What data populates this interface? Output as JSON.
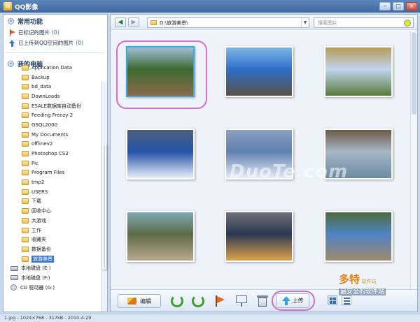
{
  "window": {
    "title": "QQ影像",
    "logo_text": "Q",
    "min": "–",
    "max": "□",
    "close": "×"
  },
  "sidebar": {
    "favorites_header": "常用功能",
    "favorites": [
      {
        "label": "已标记的图片",
        "count": "(0)",
        "icon": "flag-icon"
      },
      {
        "label": "已上传到QQ空间的图片",
        "count": "(0)",
        "icon": "upload-arrow-icon"
      }
    ],
    "computer_header": "我的电脑",
    "folders": [
      "Application Data",
      "Backup",
      "bd_data",
      "DownLoads",
      "ESALE数据库自动备份",
      "Feeding Frenzy 2",
      "GSQL2000",
      "My Documents",
      "offlinev2",
      "Photoshop CS2",
      "Pic",
      "Program Files",
      "tmp2",
      "USERS",
      "下载",
      "回收中心",
      "大游戏",
      "工作",
      "收藏夹",
      "数据备份",
      "旅游美景"
    ],
    "selected_folder_index": 20,
    "drives": [
      {
        "label": "本地磁盘 (E:)",
        "icon": "drive-icon"
      },
      {
        "label": "本地磁盘 (F:)",
        "icon": "drive-icon"
      },
      {
        "label": "CD 驱动器 (G:)",
        "icon": "cd-icon"
      }
    ]
  },
  "toolbar": {
    "back": "◀",
    "forward": "▶",
    "path": "D:\\旅游美景\\",
    "path_dropdown": "▼",
    "search_placeholder": "搜索图片"
  },
  "photos": [
    {
      "name": "water-wheel",
      "c1": "#3c6a2f",
      "c2": "#8b6a4c",
      "c3": "#9fc0d8",
      "selected": true
    },
    {
      "name": "sea-rock-arch",
      "c1": "#2d6ec9",
      "c2": "#5b5347",
      "c3": "#7fb7e6"
    },
    {
      "name": "grassland",
      "c1": "#bfd5ef",
      "c2": "#5a7a3a",
      "c3": "#b99a56"
    },
    {
      "name": "stupa-snow",
      "c1": "#2453a8",
      "c2": "#e8eef8",
      "c3": "#4d5f7a"
    },
    {
      "name": "snow-cabin",
      "c1": "#5f7fae",
      "c2": "#e6edf6",
      "c3": "#8ba1c1"
    },
    {
      "name": "lake-shore",
      "c1": "#a7b7c6",
      "c2": "#6a8aa2",
      "c3": "#6b5a48"
    },
    {
      "name": "stream-rocks",
      "c1": "#5c6b46",
      "c2": "#b8a98f",
      "c3": "#7fa9b3"
    },
    {
      "name": "sunset-sea",
      "c1": "#2a3852",
      "c2": "#e0a24a",
      "c3": "#6f6f78"
    },
    {
      "name": "mountain-peak",
      "c1": "#4d83c6",
      "c2": "#a08a6a",
      "c3": "#4d6b3a"
    }
  ],
  "bottombar": {
    "edit_label": "编辑",
    "upload_label": "上传"
  },
  "status": {
    "text": "1.jpg - 1024×768 - 317kB - 2010-4-29"
  },
  "watermarks": {
    "duote": "DuoTe.com",
    "brand": "多特",
    "brand_sub": "软件站",
    "slogan": "最安全的软件站"
  }
}
